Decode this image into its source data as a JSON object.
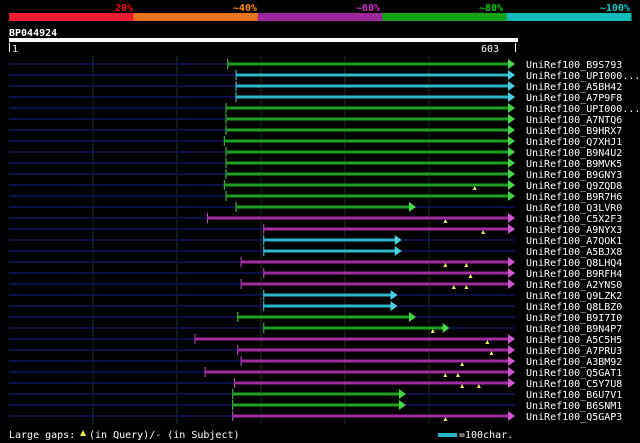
{
  "header": {
    "pct_labels": [
      {
        "label": "20%",
        "color": "#ff0000"
      },
      {
        "label": "~40%",
        "color": "#ff8c00"
      },
      {
        "label": "~60%",
        "color": "#cc33cc"
      },
      {
        "label": "~80%",
        "color": "#00cc00"
      },
      {
        "label": "~100%",
        "color": "#00cccc"
      }
    ],
    "bar_colors": [
      "#ee1c2e",
      "#e87319",
      "#9c279c",
      "#15a415",
      "#12bcbc"
    ]
  },
  "query": {
    "id": "BP044924",
    "start_label": "1",
    "end_label": "603",
    "length": 603
  },
  "colors": {
    "green": "#1f9f1f",
    "cyan": "#2ab8c8",
    "magenta": "#a02ca0",
    "navy": "#0a0f4a",
    "arrow_green": "#46d846",
    "arrow_cyan": "#4ad0e0",
    "arrow_magenta": "#d058d0",
    "gap_marker": "#f0f060"
  },
  "hits": [
    {
      "name": "UniRef100_B9S793",
      "color": "green",
      "start": 260,
      "end": 603,
      "gaps": []
    },
    {
      "name": "UniRef100_UPI000...",
      "color": "cyan",
      "start": 270,
      "end": 603,
      "gaps": []
    },
    {
      "name": "UniRef100_A5BH42",
      "color": "cyan",
      "start": 270,
      "end": 603,
      "gaps": []
    },
    {
      "name": "UniRef100_A7P9F8",
      "color": "cyan",
      "start": 270,
      "end": 603,
      "gaps": []
    },
    {
      "name": "UniRef100_UPI000...",
      "color": "green",
      "start": 258,
      "end": 603,
      "gaps": []
    },
    {
      "name": "UniRef100_A7NTQ6",
      "color": "green",
      "start": 258,
      "end": 603,
      "gaps": []
    },
    {
      "name": "UniRef100_B9HRX7",
      "color": "green",
      "start": 258,
      "end": 603,
      "gaps": []
    },
    {
      "name": "UniRef100_Q7XHJ1",
      "color": "green",
      "start": 256,
      "end": 603,
      "gaps": []
    },
    {
      "name": "UniRef100_B9N4U2",
      "color": "green",
      "start": 258,
      "end": 603,
      "gaps": []
    },
    {
      "name": "UniRef100_B9MVK5",
      "color": "green",
      "start": 258,
      "end": 603,
      "gaps": []
    },
    {
      "name": "UniRef100_B9GNY3",
      "color": "green",
      "start": 258,
      "end": 603,
      "gaps": []
    },
    {
      "name": "UniRef100_Q9ZQD8",
      "color": "green",
      "start": 256,
      "end": 603,
      "gaps": [
        555
      ]
    },
    {
      "name": "UniRef100_B9R7H6",
      "color": "green",
      "start": 258,
      "end": 603,
      "gaps": []
    },
    {
      "name": "UniRef100_Q3LVR0",
      "color": "green",
      "start": 270,
      "end": 485,
      "gaps": []
    },
    {
      "name": "UniRef100_C5X2F3",
      "color": "magenta",
      "start": 236,
      "end": 603,
      "gaps": [
        520
      ]
    },
    {
      "name": "UniRef100_A9NYX3",
      "color": "magenta",
      "start": 303,
      "end": 603,
      "gaps": [
        565
      ]
    },
    {
      "name": "UniRef100_A7QOK1",
      "color": "cyan",
      "start": 303,
      "end": 468,
      "gaps": []
    },
    {
      "name": "UniRef100_A5BJX8",
      "color": "cyan",
      "start": 303,
      "end": 468,
      "gaps": []
    },
    {
      "name": "UniRef100_Q8LHQ4",
      "color": "magenta",
      "start": 276,
      "end": 603,
      "gaps": [
        520,
        545
      ]
    },
    {
      "name": "UniRef100_B9RFH4",
      "color": "magenta",
      "start": 303,
      "end": 603,
      "gaps": [
        550
      ]
    },
    {
      "name": "UniRef100_A2YNS0",
      "color": "magenta",
      "start": 276,
      "end": 603,
      "gaps": [
        530,
        545
      ]
    },
    {
      "name": "UniRef100_Q9LZK2",
      "color": "cyan",
      "start": 303,
      "end": 463,
      "gaps": []
    },
    {
      "name": "UniRef100_Q8LBZ0",
      "color": "cyan",
      "start": 303,
      "end": 463,
      "gaps": []
    },
    {
      "name": "UniRef100_B9I7I0",
      "color": "green",
      "start": 272,
      "end": 485,
      "gaps": []
    },
    {
      "name": "UniRef100_B9N4P7",
      "color": "green",
      "start": 303,
      "end": 525,
      "gaps": [
        505
      ]
    },
    {
      "name": "UniRef100_A5C5H5",
      "color": "magenta",
      "start": 221,
      "end": 603,
      "gaps": [
        570
      ]
    },
    {
      "name": "UniRef100_A7PRU3",
      "color": "magenta",
      "start": 272,
      "end": 603,
      "gaps": [
        575
      ]
    },
    {
      "name": "UniRef100_A3BM92",
      "color": "magenta",
      "start": 276,
      "end": 603,
      "gaps": [
        540
      ]
    },
    {
      "name": "UniRef100_Q5GAT1",
      "color": "magenta",
      "start": 233,
      "end": 603,
      "gaps": [
        520,
        535
      ]
    },
    {
      "name": "UniRef100_C5Y7U8",
      "color": "magenta",
      "start": 268,
      "end": 603,
      "gaps": [
        540,
        560
      ]
    },
    {
      "name": "UniRef100_B6U7V1",
      "color": "green",
      "start": 266,
      "end": 473,
      "gaps": []
    },
    {
      "name": "UniRef100_B6SNM1",
      "color": "green",
      "start": 266,
      "end": 473,
      "gaps": []
    },
    {
      "name": "UniRef100_Q5GAP3",
      "color": "magenta",
      "start": 266,
      "end": 603,
      "gaps": [
        520
      ]
    }
  ],
  "footer": {
    "gap_legend_prefix": "Large gaps: ",
    "gap_legend_query": "(in Query)/- (in Subject)",
    "scale_label": "=100char."
  }
}
